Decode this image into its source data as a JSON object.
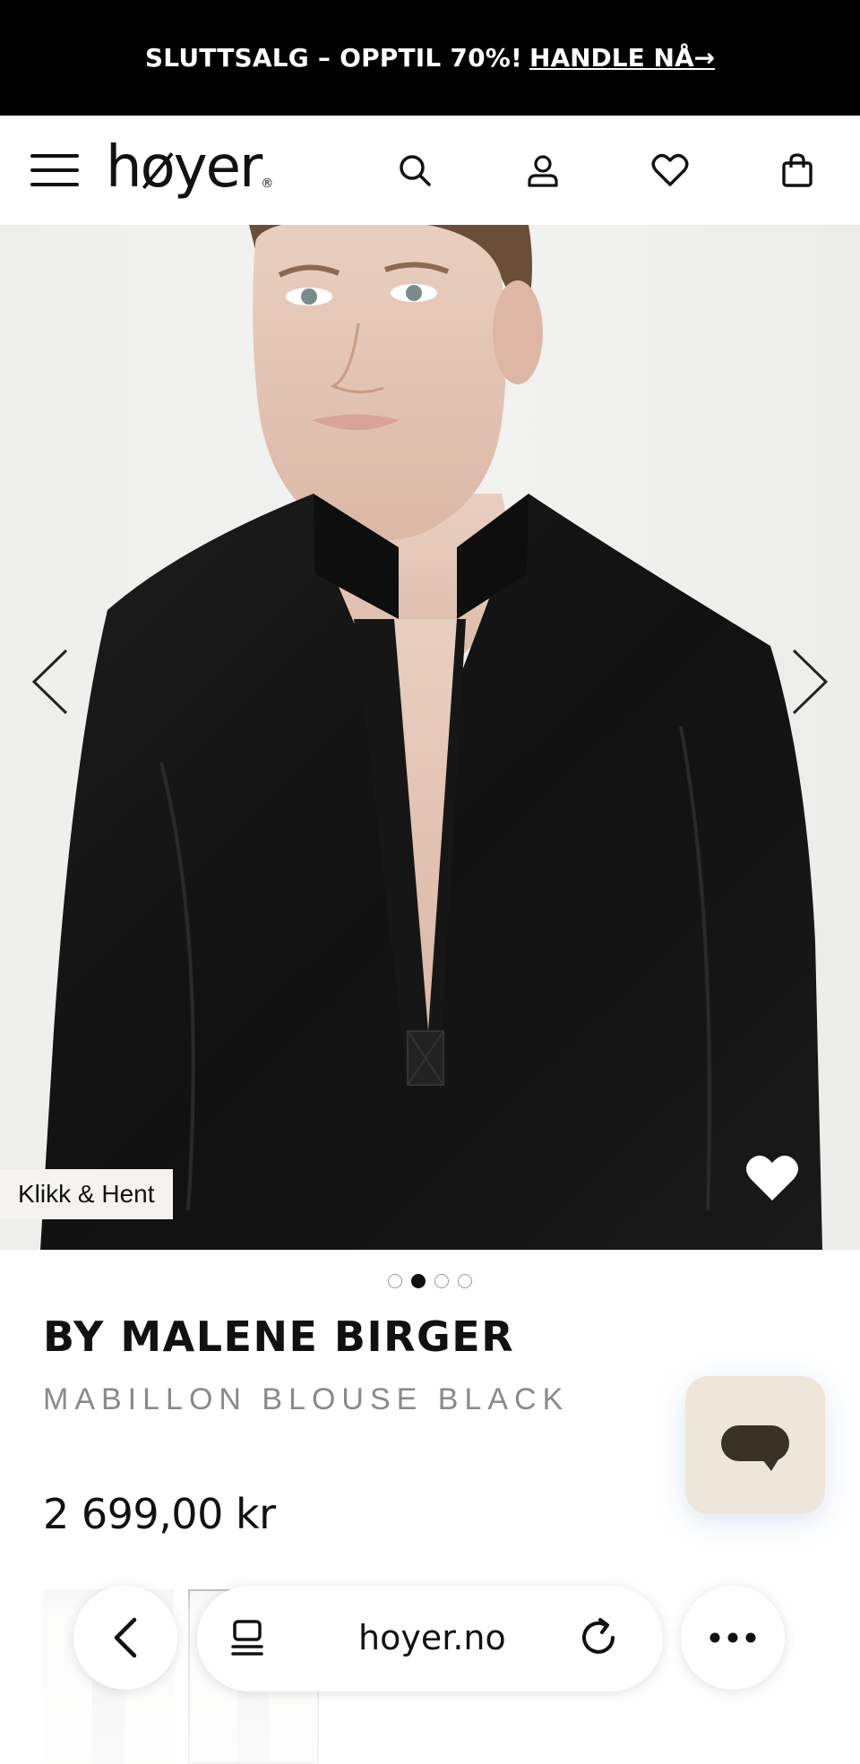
{
  "promo": {
    "text": "SLUTTSALG – OPPTIL 70%!",
    "link": "HANDLE NÅ→"
  },
  "header": {
    "logo": "høyer",
    "logo_mark": "®",
    "icons": [
      "menu-icon",
      "search-icon",
      "user-icon",
      "heart-icon",
      "shopping-bag-icon"
    ]
  },
  "hero": {
    "badge": "Klikk & Hent",
    "slides_total": 4,
    "active_slide": 2
  },
  "product": {
    "brand": "BY MALENE BIRGER",
    "name": "MABILLON BLOUSE BLACK",
    "price": "2 699,00 kr"
  },
  "browser": {
    "url": "hoyer.no",
    "icons": [
      "back-icon",
      "tabs-icon",
      "reload-icon",
      "more-icon"
    ]
  },
  "colors": {
    "banner_bg": "#000000",
    "chat_bg": "#efe6da",
    "chat_icon": "#3b3226",
    "muted_text": "#8a8a8a"
  }
}
